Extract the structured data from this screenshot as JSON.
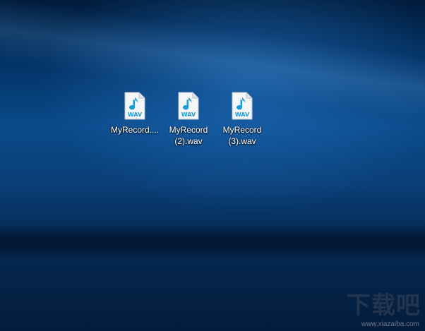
{
  "desktop": {
    "icons": [
      {
        "label": "MyRecord....",
        "badge": "WAV",
        "icon": "wav-audio-file-icon"
      },
      {
        "label": "MyRecord\n(2).wav",
        "badge": "WAV",
        "icon": "wav-audio-file-icon"
      },
      {
        "label": "MyRecord\n(3).wav",
        "badge": "WAV",
        "icon": "wav-audio-file-icon"
      }
    ]
  },
  "watermark": {
    "logo_text": "下载吧",
    "url": "www.xiazaiba.com"
  },
  "colors": {
    "icon_note": "#1e9ad6",
    "icon_badge": "#1e9ad6",
    "label_text": "#ffffff"
  }
}
